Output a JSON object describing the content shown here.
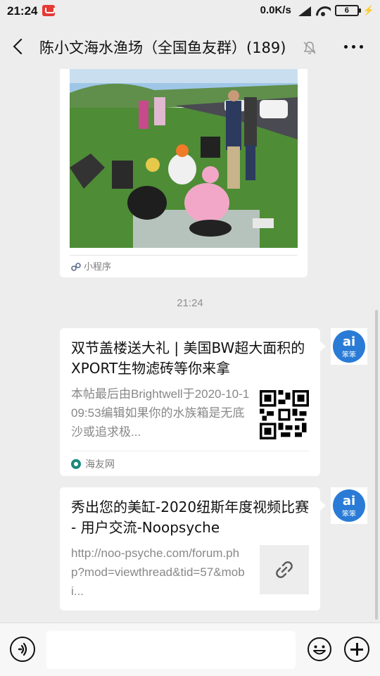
{
  "status_bar": {
    "time": "21:24",
    "network_speed": "0.0K/s",
    "battery_level": "6"
  },
  "header": {
    "title": "陈小文海水渔场（全国鱼友群）(189)",
    "back_icon": "back-arrow-icon",
    "mute_icon": "bell-off-icon",
    "more_icon": "more-dots-icon"
  },
  "chat": {
    "mini_program_card": {
      "label": "小程序"
    },
    "timestamp": "21:24",
    "messages": [
      {
        "title": "双节盖楼送大礼 | 美国BW超大面积的XPORT生物滤砖等你来拿",
        "description": "本帖最后由Brightwell于2020-10-109:53编辑如果你的水族箱是无底沙或追求极...",
        "source": "海友网",
        "thumbnail": "qr-code"
      },
      {
        "title": "秀出您的美缸-2020纽斯年度视频比赛 - 用户交流-Noopsyche",
        "description": "http://noo-psyche.com/forum.php?mod=viewthread&tid=57&mobi...",
        "thumbnail": "link-icon"
      }
    ]
  },
  "input_bar": {
    "voice_icon": "voice-icon",
    "emoji_icon": "emoji-icon",
    "plus_icon": "plus-icon"
  }
}
